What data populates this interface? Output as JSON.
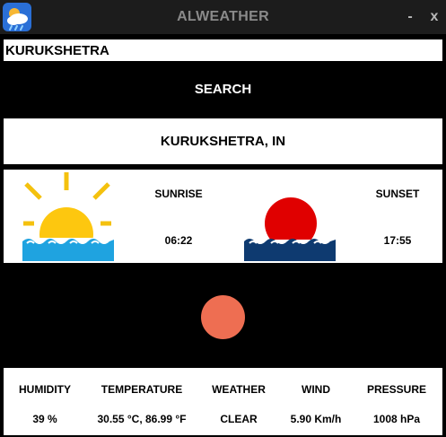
{
  "app": {
    "title": "ALWEATHER",
    "minimize_label": "-",
    "close_label": "x"
  },
  "search": {
    "value": "KURUKSHETRA",
    "button_label": "SEARCH"
  },
  "location": {
    "label": "KURUKSHETRA, IN"
  },
  "sun": {
    "sunrise_label": "SUNRISE",
    "sunrise_time": "06:22",
    "sunset_label": "SUNSET",
    "sunset_time": "17:55"
  },
  "stats": [
    {
      "label": "HUMIDITY",
      "value": "39 %"
    },
    {
      "label": "TEMPERATURE",
      "value": "30.55 °C, 86.99 °F"
    },
    {
      "label": "WEATHER",
      "value": "CLEAR"
    },
    {
      "label": "WIND",
      "value": "5.90 Km/h"
    },
    {
      "label": "PRESSURE",
      "value": "1008 hPa"
    }
  ],
  "colors": {
    "sunrise_sun": "#fdc70f",
    "sunrise_rays": "#f4c10e",
    "sunrise_water": "#1fa3e0",
    "sunset_sun": "#e00000",
    "sunset_water": "#0e3a70",
    "weather_indicator": "#ee6e52",
    "title_text": "#8a8a8a"
  },
  "icons": {
    "app": "weather-app-icon",
    "sunrise": "sunrise-icon",
    "sunset": "sunset-icon",
    "weather": "weather-condition-icon"
  }
}
